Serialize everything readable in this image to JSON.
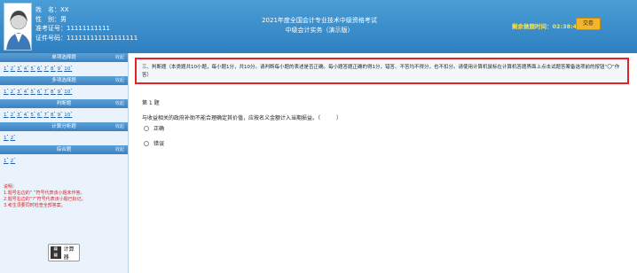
{
  "candidate": {
    "name_label": "姓　名：",
    "name_value": "XX",
    "gender_label": "性　别：",
    "gender_value": "男",
    "ticket_label": "准考证号：",
    "ticket_value": "11111111111",
    "id_label": "证件号码：",
    "id_value": "111111111111111111"
  },
  "exam": {
    "title": "2021年度全国会计专业技术中级资格考试",
    "subtitle": "中级会计实务（演示版）"
  },
  "timer": {
    "label": "剩余做题时间：",
    "value": "02:38:47"
  },
  "submit_label": "交卷",
  "sidebar": {
    "toggle_label": "收起",
    "sections": [
      {
        "title": "单项选择题",
        "numbers": [
          "1",
          "2",
          "3",
          "4",
          "5",
          "6",
          "7",
          "8",
          "9",
          "10"
        ]
      },
      {
        "title": "多项选择题",
        "numbers": [
          "1",
          "2",
          "3",
          "4",
          "5",
          "6",
          "7",
          "8",
          "9",
          "10"
        ]
      },
      {
        "title": "判断题",
        "numbers": [
          "1",
          "2",
          "3",
          "4",
          "5",
          "6",
          "7",
          "8",
          "9",
          "10"
        ]
      },
      {
        "title": "计算分析题",
        "numbers": [
          "1",
          "2"
        ]
      },
      {
        "title": "综合题",
        "numbers": [
          "1",
          "2"
        ]
      }
    ],
    "notes": {
      "title": "说明：",
      "line1": "1.题号右边的“ ”符号代表该小题未作答。",
      "line2": "2.题号右边的“?”符号代表该小题已标记。",
      "line3": "3.考生须要同时检查全部答案。"
    },
    "calculator_label": "计算器"
  },
  "question": {
    "instructions": "三、判断题（本类题共10小题，每小题1分，共10分。请判断每小题的表述是否正确。每小题答题正确的得1分，错答、不答均不得分，也不扣分。请使用计算机鼠标在计算机答题界面上点击试题答案备选项前的按钮“〇”作答）",
    "number": "第 1 题",
    "text": "与收益相关的政府补助不能合理确定其价值，应按名义金额计入当期损益。（　　　）",
    "options": [
      "正确",
      "错误"
    ]
  }
}
